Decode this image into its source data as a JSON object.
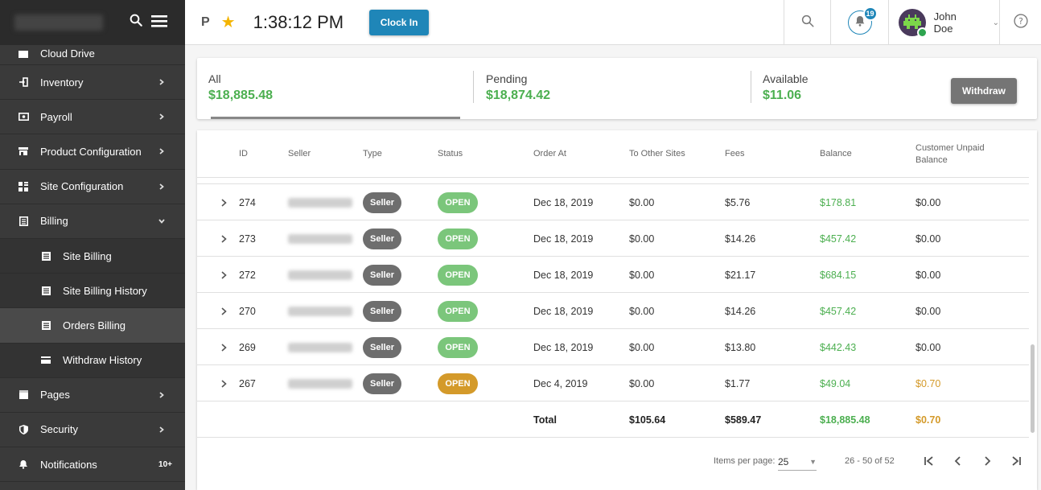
{
  "sidebar": {
    "items": [
      {
        "label": "Cloud Drive",
        "icon": "folder-icon",
        "chevron": false,
        "sub": false,
        "cut": true
      },
      {
        "label": "Inventory",
        "icon": "login-icon",
        "chevron": true,
        "sub": false
      },
      {
        "label": "Payroll",
        "icon": "money-icon",
        "chevron": true,
        "sub": false
      },
      {
        "label": "Product Configuration",
        "icon": "store-icon",
        "chevron": true,
        "sub": false
      },
      {
        "label": "Site Configuration",
        "icon": "grid-icon",
        "chevron": true,
        "sub": false
      },
      {
        "label": "Billing",
        "icon": "document-icon",
        "chevron": "down",
        "sub": false
      },
      {
        "label": "Site Billing",
        "icon": "list-icon",
        "chevron": false,
        "sub": true
      },
      {
        "label": "Site Billing History",
        "icon": "list-icon",
        "chevron": false,
        "sub": true
      },
      {
        "label": "Orders Billing",
        "icon": "list-icon",
        "chevron": false,
        "sub": true,
        "active": true
      },
      {
        "label": "Withdraw History",
        "icon": "card-icon",
        "chevron": false,
        "sub": true
      },
      {
        "label": "Pages",
        "icon": "page-icon",
        "chevron": true,
        "sub": false
      },
      {
        "label": "Security",
        "icon": "shield-icon",
        "chevron": true,
        "sub": false
      },
      {
        "label": "Notifications",
        "icon": "bell-icon",
        "chevron": false,
        "sub": false,
        "badge": "10+"
      }
    ]
  },
  "topbar": {
    "p_label": "P",
    "time": "1:38:12 PM",
    "clock_in": "Clock In",
    "notif_count": "19",
    "user_name": "John Doe"
  },
  "summary": {
    "all_label": "All",
    "all_value": "$18,885.48",
    "pending_label": "Pending",
    "pending_value": "$18,874.42",
    "available_label": "Available",
    "available_value": "$11.06",
    "withdraw_label": "Withdraw"
  },
  "table": {
    "headers": {
      "id": "ID",
      "seller": "Seller",
      "type": "Type",
      "status": "Status",
      "order_at": "Order At",
      "to_other": "To Other Sites",
      "fees": "Fees",
      "balance": "Balance",
      "unpaid_1": "Customer Unpaid",
      "unpaid_2": "Balance"
    },
    "rows": [
      {
        "id": "274",
        "type": "Seller",
        "status": "OPEN",
        "status_warn": false,
        "order_at": "Dec 18, 2019",
        "to_other": "$0.00",
        "fees": "$5.76",
        "balance": "$178.81",
        "unpaid": "$0.00",
        "unpaid_warn": false
      },
      {
        "id": "273",
        "type": "Seller",
        "status": "OPEN",
        "status_warn": false,
        "order_at": "Dec 18, 2019",
        "to_other": "$0.00",
        "fees": "$14.26",
        "balance": "$457.42",
        "unpaid": "$0.00",
        "unpaid_warn": false
      },
      {
        "id": "272",
        "type": "Seller",
        "status": "OPEN",
        "status_warn": false,
        "order_at": "Dec 18, 2019",
        "to_other": "$0.00",
        "fees": "$21.17",
        "balance": "$684.15",
        "unpaid": "$0.00",
        "unpaid_warn": false
      },
      {
        "id": "270",
        "type": "Seller",
        "status": "OPEN",
        "status_warn": false,
        "order_at": "Dec 18, 2019",
        "to_other": "$0.00",
        "fees": "$14.26",
        "balance": "$457.42",
        "unpaid": "$0.00",
        "unpaid_warn": false
      },
      {
        "id": "269",
        "type": "Seller",
        "status": "OPEN",
        "status_warn": false,
        "order_at": "Dec 18, 2019",
        "to_other": "$0.00",
        "fees": "$13.80",
        "balance": "$442.43",
        "unpaid": "$0.00",
        "unpaid_warn": false
      },
      {
        "id": "267",
        "type": "Seller",
        "status": "OPEN",
        "status_warn": true,
        "order_at": "Dec 4, 2019",
        "to_other": "$0.00",
        "fees": "$1.77",
        "balance": "$49.04",
        "unpaid": "$0.70",
        "unpaid_warn": true
      }
    ],
    "total": {
      "label": "Total",
      "to_other": "$105.64",
      "fees": "$589.47",
      "balance": "$18,885.48",
      "unpaid": "$0.70"
    }
  },
  "paginator": {
    "items_label": "Items per page:",
    "page_size": "25",
    "range": "26 - 50 of 52"
  },
  "colors": {
    "accent": "#1f86b8",
    "green": "#4caf50",
    "orange": "#d49a2a",
    "sidebar": "#3a3a3a"
  }
}
